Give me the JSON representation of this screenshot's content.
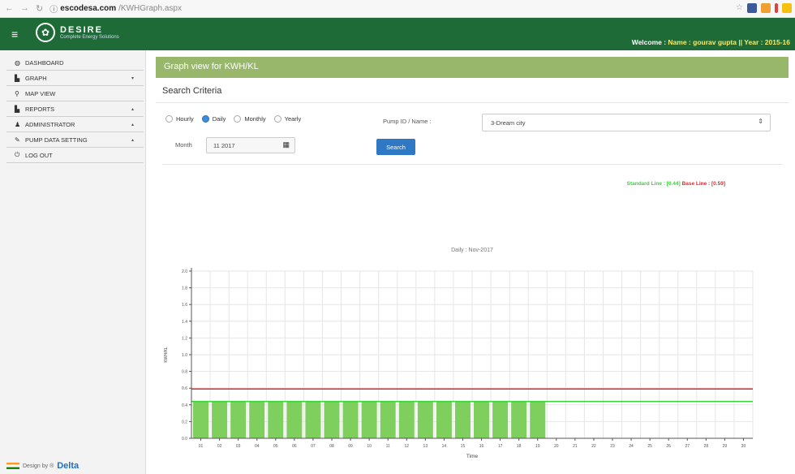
{
  "browser": {
    "url_domain": "escodesa.com",
    "url_path": "/KWHGraph.aspx"
  },
  "header": {
    "brand": "DESIRE",
    "tagline": "Complete Energy Solutions",
    "welcome_prefix": "Welcome : ",
    "welcome_details": "Name : gourav gupta || Year : 2015-16"
  },
  "sidebar": {
    "items": [
      {
        "label": "DASHBOARD",
        "icon": "dashboard-icon",
        "glyph": "◍",
        "caret": ""
      },
      {
        "label": "GRAPH",
        "icon": "graph-icon",
        "glyph": "▙",
        "caret": "▾"
      },
      {
        "label": "MAP VIEW",
        "icon": "map-marker-icon",
        "glyph": "⚲",
        "caret": ""
      },
      {
        "label": "REPORTS",
        "icon": "reports-icon",
        "glyph": "▙",
        "caret": "▴"
      },
      {
        "label": "ADMINISTRATOR",
        "icon": "user-icon",
        "glyph": "♟",
        "caret": "▴"
      },
      {
        "label": "PUMP DATA SETTING",
        "icon": "wrench-icon",
        "glyph": "✎",
        "caret": "▴"
      },
      {
        "label": "LOG OUT",
        "icon": "power-icon",
        "glyph": "⏻",
        "caret": ""
      }
    ],
    "footer_prefix": "Design by ®",
    "footer_brand": "Delta"
  },
  "panel": {
    "title": "Graph view for KWH/KL",
    "search_title": "Search Criteria"
  },
  "filters": {
    "radios": [
      {
        "label": "Hourly",
        "checked": false
      },
      {
        "label": "Daily",
        "checked": true
      },
      {
        "label": "Monthly",
        "checked": false
      },
      {
        "label": "Yearly",
        "checked": false
      }
    ],
    "pump_label": "Pump ID / Name :",
    "pump_value": "3-Dream city",
    "month_label": "Month",
    "month_value": "11 2017",
    "search_label": "Search"
  },
  "legend": {
    "standard": "Standard Line : [0.44]",
    "base": "Base Line : [0.59]"
  },
  "colors": {
    "header": "#1f6b37",
    "panel_head": "#98b76a",
    "bar": "#7fcf5f",
    "standard_line": "#35d535",
    "base_line": "#e8262a",
    "accent": "#2f78c4"
  },
  "chart_data": {
    "type": "bar",
    "title": "Daily : Nov-2017",
    "xlabel": "Time",
    "ylabel": "KWH/KL",
    "categories": [
      "01",
      "02",
      "03",
      "04",
      "05",
      "06",
      "07",
      "08",
      "09",
      "10",
      "11",
      "12",
      "13",
      "14",
      "15",
      "16",
      "17",
      "18",
      "19",
      "20",
      "21",
      "22",
      "23",
      "24",
      "25",
      "26",
      "27",
      "28",
      "29",
      "30"
    ],
    "values": [
      0.44,
      0.44,
      0.44,
      0.44,
      0.44,
      0.44,
      0.44,
      0.44,
      0.44,
      0.44,
      0.44,
      0.44,
      0.44,
      0.44,
      0.44,
      0.44,
      0.44,
      0.44,
      0.44,
      0,
      0,
      0,
      0,
      0,
      0,
      0,
      0,
      0,
      0,
      0
    ],
    "ylim": [
      0,
      2.0
    ],
    "yticks": [
      "0.0",
      "0.2",
      "0.4",
      "0.6",
      "0.8",
      "1.0",
      "1.2",
      "1.4",
      "1.6",
      "1.8",
      "2.0"
    ],
    "standard_line": 0.44,
    "base_line": 0.59,
    "grid": true
  }
}
